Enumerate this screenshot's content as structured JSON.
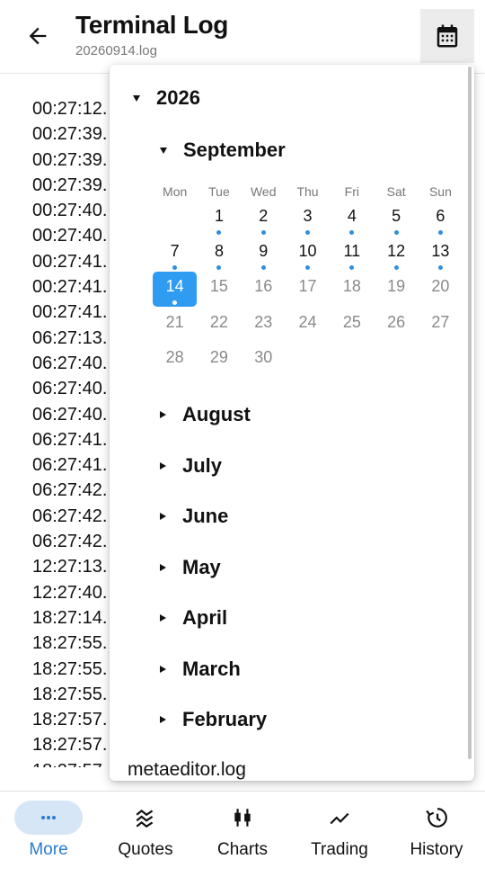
{
  "header": {
    "title": "Terminal Log",
    "subtitle": "20260914.log"
  },
  "log_lines": [
    "00:27:12.",
    "00:27:39.",
    "00:27:39.",
    "00:27:39.",
    "00:27:40.",
    "00:27:40.",
    "00:27:41.",
    "00:27:41.",
    "00:27:41.",
    "06:27:13.",
    "06:27:40.",
    "06:27:40.",
    "06:27:40.",
    "06:27:41.",
    "06:27:41.",
    "06:27:42.",
    "06:27:42.",
    "06:27:42.",
    "12:27:13.",
    "12:27:40.",
    "18:27:14.",
    "18:27:55.",
    "18:27:55.",
    "18:27:55.",
    "18:27:57.",
    "18:27:57.",
    "18:27:57."
  ],
  "dropdown": {
    "year": "2026",
    "expanded_month": "September",
    "weekdays": [
      "Mon",
      "Tue",
      "Wed",
      "Thu",
      "Fri",
      "Sat",
      "Sun"
    ],
    "first_day_offset": 1,
    "days": [
      {
        "n": "1",
        "log": true
      },
      {
        "n": "2",
        "log": true
      },
      {
        "n": "3",
        "log": true
      },
      {
        "n": "4",
        "log": true
      },
      {
        "n": "5",
        "log": true
      },
      {
        "n": "6",
        "log": true
      },
      {
        "n": "7",
        "log": true
      },
      {
        "n": "8",
        "log": true
      },
      {
        "n": "9",
        "log": true
      },
      {
        "n": "10",
        "log": true
      },
      {
        "n": "11",
        "log": true
      },
      {
        "n": "12",
        "log": true
      },
      {
        "n": "13",
        "log": true
      },
      {
        "n": "14",
        "log": true,
        "selected": true
      },
      {
        "n": "15",
        "log": false
      },
      {
        "n": "16",
        "log": false
      },
      {
        "n": "17",
        "log": false
      },
      {
        "n": "18",
        "log": false
      },
      {
        "n": "19",
        "log": false
      },
      {
        "n": "20",
        "log": false
      },
      {
        "n": "21",
        "log": false
      },
      {
        "n": "22",
        "log": false
      },
      {
        "n": "23",
        "log": false
      },
      {
        "n": "24",
        "log": false
      },
      {
        "n": "25",
        "log": false
      },
      {
        "n": "26",
        "log": false
      },
      {
        "n": "27",
        "log": false
      },
      {
        "n": "28",
        "log": false
      },
      {
        "n": "29",
        "log": false
      },
      {
        "n": "30",
        "log": false
      }
    ],
    "collapsed_months": [
      "August",
      "July",
      "June",
      "May",
      "April",
      "March",
      "February"
    ],
    "file_item": "metaeditor.log"
  },
  "bottom_nav": [
    {
      "label": "More",
      "icon": "more-dots-icon",
      "active": true
    },
    {
      "label": "Quotes",
      "icon": "quotes-icon",
      "active": false
    },
    {
      "label": "Charts",
      "icon": "candlestick-icon",
      "active": false
    },
    {
      "label": "Trading",
      "icon": "trend-line-icon",
      "active": false
    },
    {
      "label": "History",
      "icon": "history-icon",
      "active": false
    }
  ],
  "colors": {
    "accent": "#2f9cf1",
    "dot": "#2f8fe0",
    "nav_active": "#2a7bd0"
  }
}
